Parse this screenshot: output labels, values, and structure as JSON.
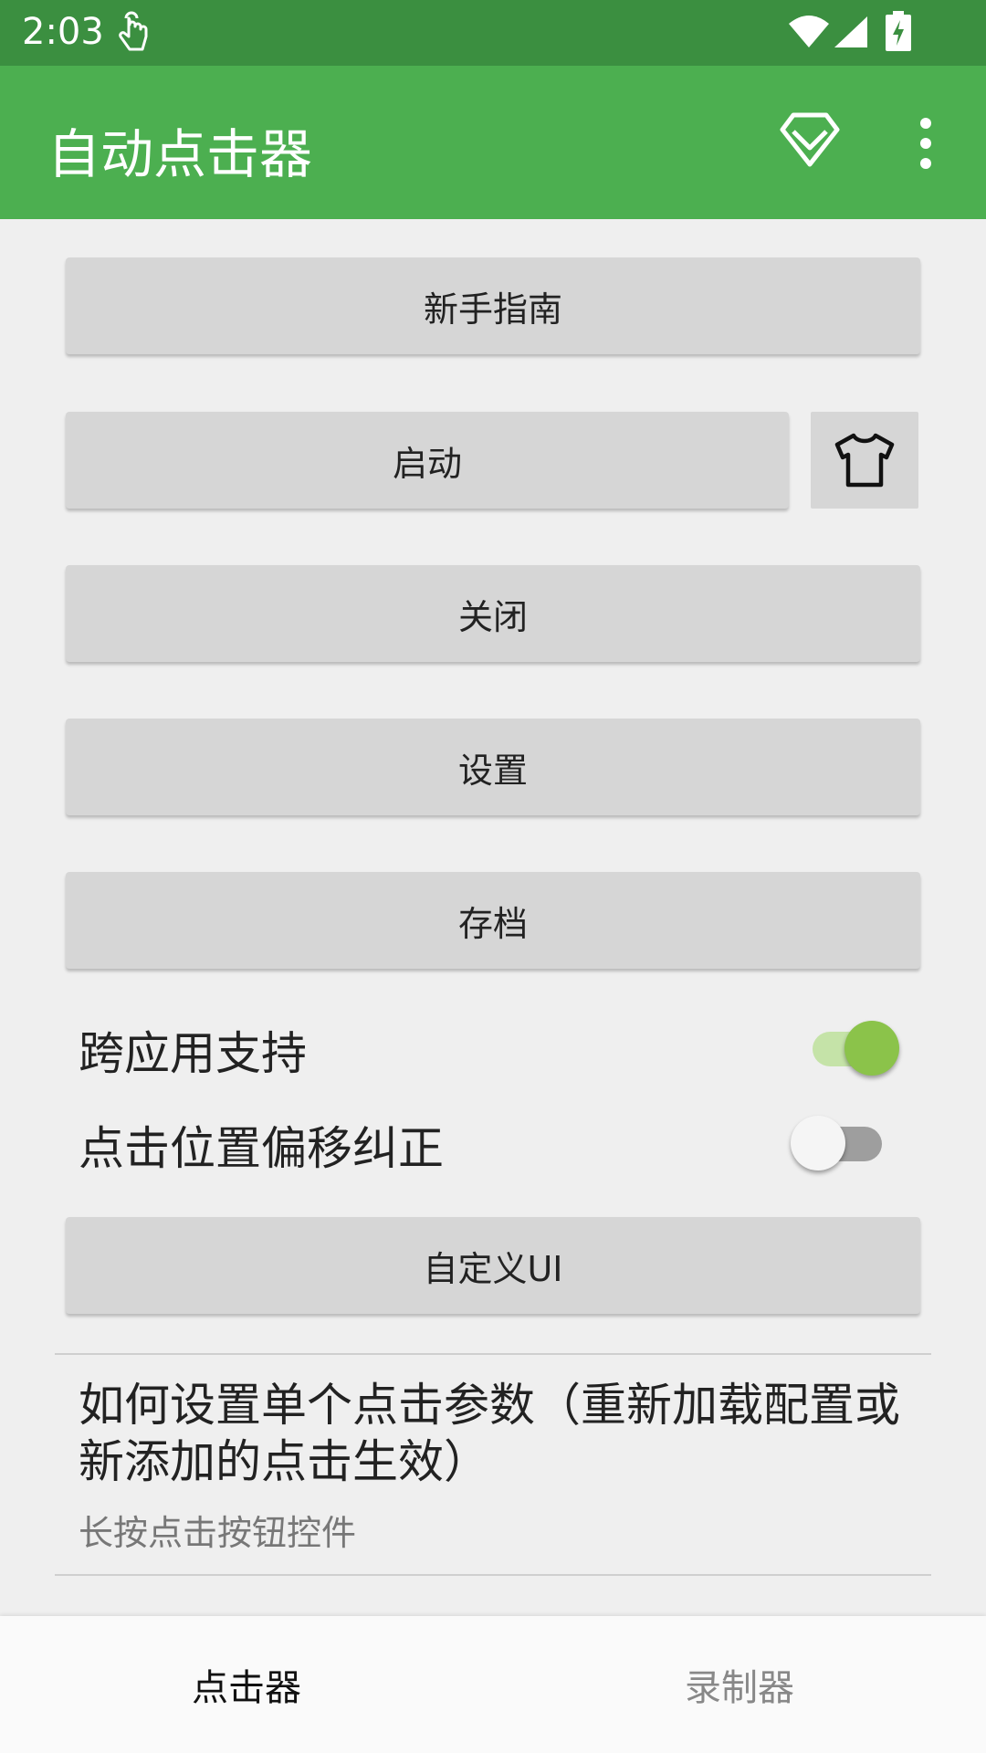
{
  "status_bar": {
    "time": "2:03",
    "icons": [
      "touch-icon",
      "wifi-icon",
      "cellular-icon",
      "battery-charging-icon"
    ]
  },
  "app_bar": {
    "title": "自动点击器",
    "actions": [
      "diamond-icon",
      "more-vert-icon"
    ],
    "background": "#4caf50"
  },
  "buttons": {
    "guide": "新手指南",
    "start": "启动",
    "close": "关闭",
    "settings": "设置",
    "archive": "存档",
    "custom_ui": "自定义UI"
  },
  "toggles": [
    {
      "label": "跨应用支持",
      "on": true
    },
    {
      "label": "点击位置偏移纠正",
      "on": false
    }
  ],
  "help": {
    "title": "如何设置单个点击参数（重新加载配置或新添加的点击生效）",
    "subtitle": "长按点击按钮控件"
  },
  "bottom_nav": {
    "tabs": [
      {
        "label": "点击器",
        "active": true
      },
      {
        "label": "录制器",
        "active": false
      }
    ]
  },
  "colors": {
    "status_bar": "#3b8f40",
    "accent": "#8bc34a"
  }
}
